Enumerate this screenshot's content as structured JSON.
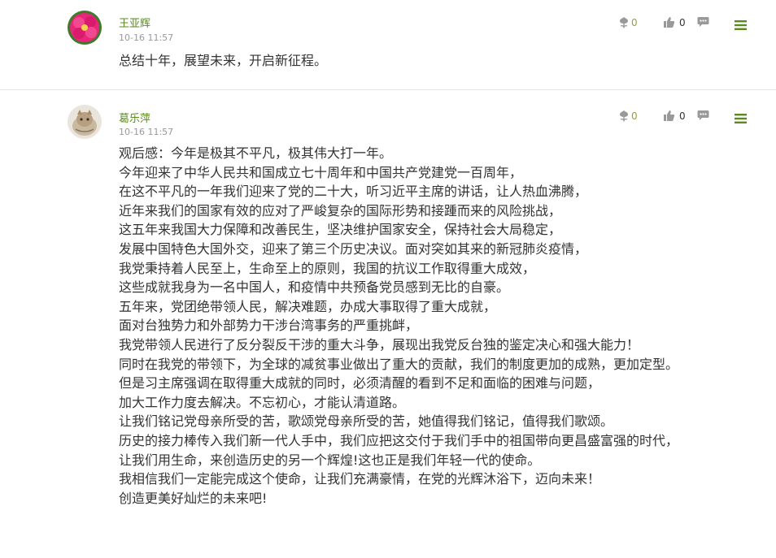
{
  "comments": [
    {
      "author": "王亚辉",
      "time": "10-16 11:57",
      "flowers": "0",
      "likes": "0",
      "lines": [
        "总结十年，展望未来，开启新征程。"
      ]
    },
    {
      "author": "葛乐萍",
      "time": "10-16 11:57",
      "flowers": "0",
      "likes": "0",
      "lines": [
        "观后感：今年是极其不平凡，极其伟大打一年。",
        "今年迎来了中华人民共和国成立七十周年和中国共产党建党一百周年，",
        "在这不平凡的一年我们迎来了党的二十大，听习近平主席的讲话，让人热血沸腾，",
        "近年来我们的国家有效的应对了严峻复杂的国际形势和接踵而来的风险挑战，",
        "这五年来我国大力保障和改善民生，坚决维护国家安全，保持社会大局稳定，",
        "发展中国特色大国外交，迎来了第三个历史决议。面对突如其来的新冠肺炎疫情，",
        "我党秉持着人民至上，生命至上的原则，我国的抗议工作取得重大成效，",
        "这些成就我身为一名中国人，和疫情中共预备党员感到无比的自豪。",
        "五年来，党团绝带领人民，解决难题，办成大事取得了重大成就，",
        "面对台独势力和外部势力干涉台湾事务的严重挑衅，",
        "我党带领人民进行了反分裂反干涉的重大斗争，展现出我党反台独的鉴定决心和强大能力！",
        "同时在我党的带领下，为全球的减贫事业做出了重大的贡献，我们的制度更加的成熟，更加定型。",
        "但是习主席强调在取得重大成就的同时，必须清醒的看到不足和面临的困难与问题，",
        "加大工作力度去解决。不忘初心，才能认清道路。",
        "让我们铭记党母亲所受的苦，歌颂党母亲所受的苦，她值得我们铭记，值得我们歌颂。",
        "历史的接力棒传入我们新一代人手中，我们应把这交付于我们手中的祖国带向更昌盛富强的时代，",
        "让我们用生命，来创造历史的另一个辉煌!这也正是我们年轻一代的使命。",
        "我相信我们一定能完成这个使命，让我们充满豪情，在党的光辉沐浴下，迈向未来！",
        "创造更美好灿烂的未来吧!"
      ]
    }
  ],
  "colors": {
    "author": "#5a8a1e",
    "flower_count": "#8aa63b",
    "menu": "#5a8a1e",
    "icon_gray": "#999999",
    "divider": "#e6e6e6"
  },
  "icons": {
    "flower": "flower-icon",
    "like": "thumbs-up-icon",
    "reply": "speech-bubble-icon",
    "menu": "menu-icon"
  }
}
